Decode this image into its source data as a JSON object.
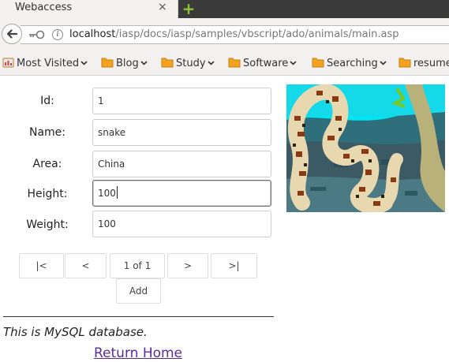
{
  "browser": {
    "tab_title": "Webaccess",
    "tab_close": "×",
    "new_tab": "+",
    "url_host": "localhost",
    "url_path": "/iasp/docs/iasp/samples/vbscript/ado/animals/main.asp",
    "bookmarks": [
      "Most Visited",
      "Blog",
      "Study",
      "Software",
      "Searching",
      "resume"
    ]
  },
  "form": {
    "id_label": "Id:",
    "id_value": "1",
    "name_label": "Name:",
    "name_value": "snake",
    "area_label": "Area:",
    "area_value": "China",
    "height_label": "Height:",
    "height_value": "100",
    "weight_label": "Weight:",
    "weight_value": "100"
  },
  "pager": {
    "first": "|<",
    "prev": "<",
    "position": "1 of 1",
    "next": ">",
    "last": ">|",
    "add": "Add"
  },
  "footer": {
    "db_note": "This is MySQL database.",
    "home_link": "Return Home"
  },
  "colors": {
    "link_visited": "#5a2ca0",
    "folder_orange": "#f2a21c",
    "picture_cyan": "#00e8f0"
  }
}
